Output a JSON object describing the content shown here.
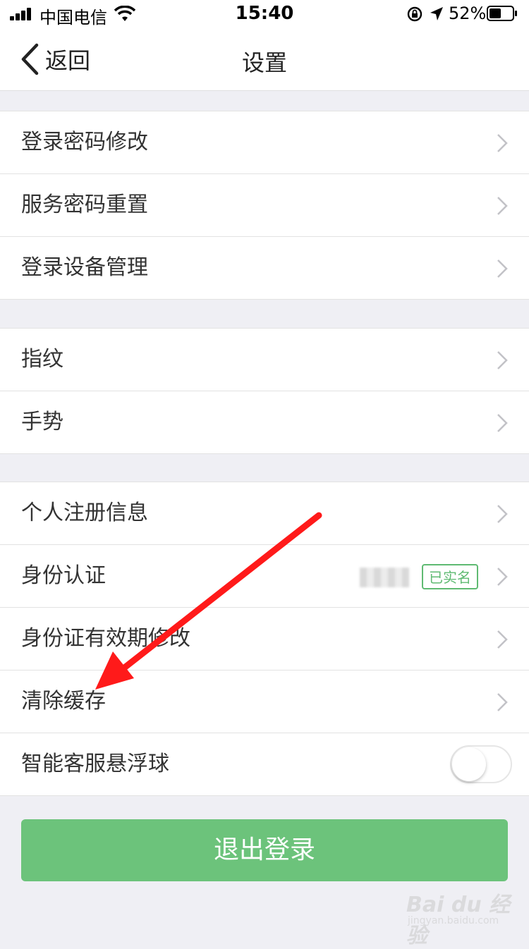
{
  "status_bar": {
    "carrier": "中国电信",
    "time": "15:40",
    "battery": "52%",
    "battery_level": 0.52
  },
  "nav": {
    "back_label": "返回",
    "title": "设置"
  },
  "groups": [
    {
      "items": [
        {
          "label": "登录密码修改"
        },
        {
          "label": "服务密码重置"
        },
        {
          "label": "登录设备管理"
        }
      ]
    },
    {
      "items": [
        {
          "label": "指纹"
        },
        {
          "label": "手势"
        }
      ]
    },
    {
      "items": [
        {
          "label": "个人注册信息"
        },
        {
          "label": "身份认证",
          "badge": "已实名"
        },
        {
          "label": "身份证有效期修改"
        },
        {
          "label": "清除缓存"
        },
        {
          "label": "智能客服悬浮球",
          "toggle": false
        }
      ]
    }
  ],
  "logout_label": "退出登录",
  "watermark": {
    "main": "Bai du 经验",
    "sub": "jingyan.baidu.com"
  },
  "colors": {
    "accent_green": "#6cc37b",
    "badge_green": "#5fba72",
    "annotation_arrow": "#ff1a1a"
  }
}
